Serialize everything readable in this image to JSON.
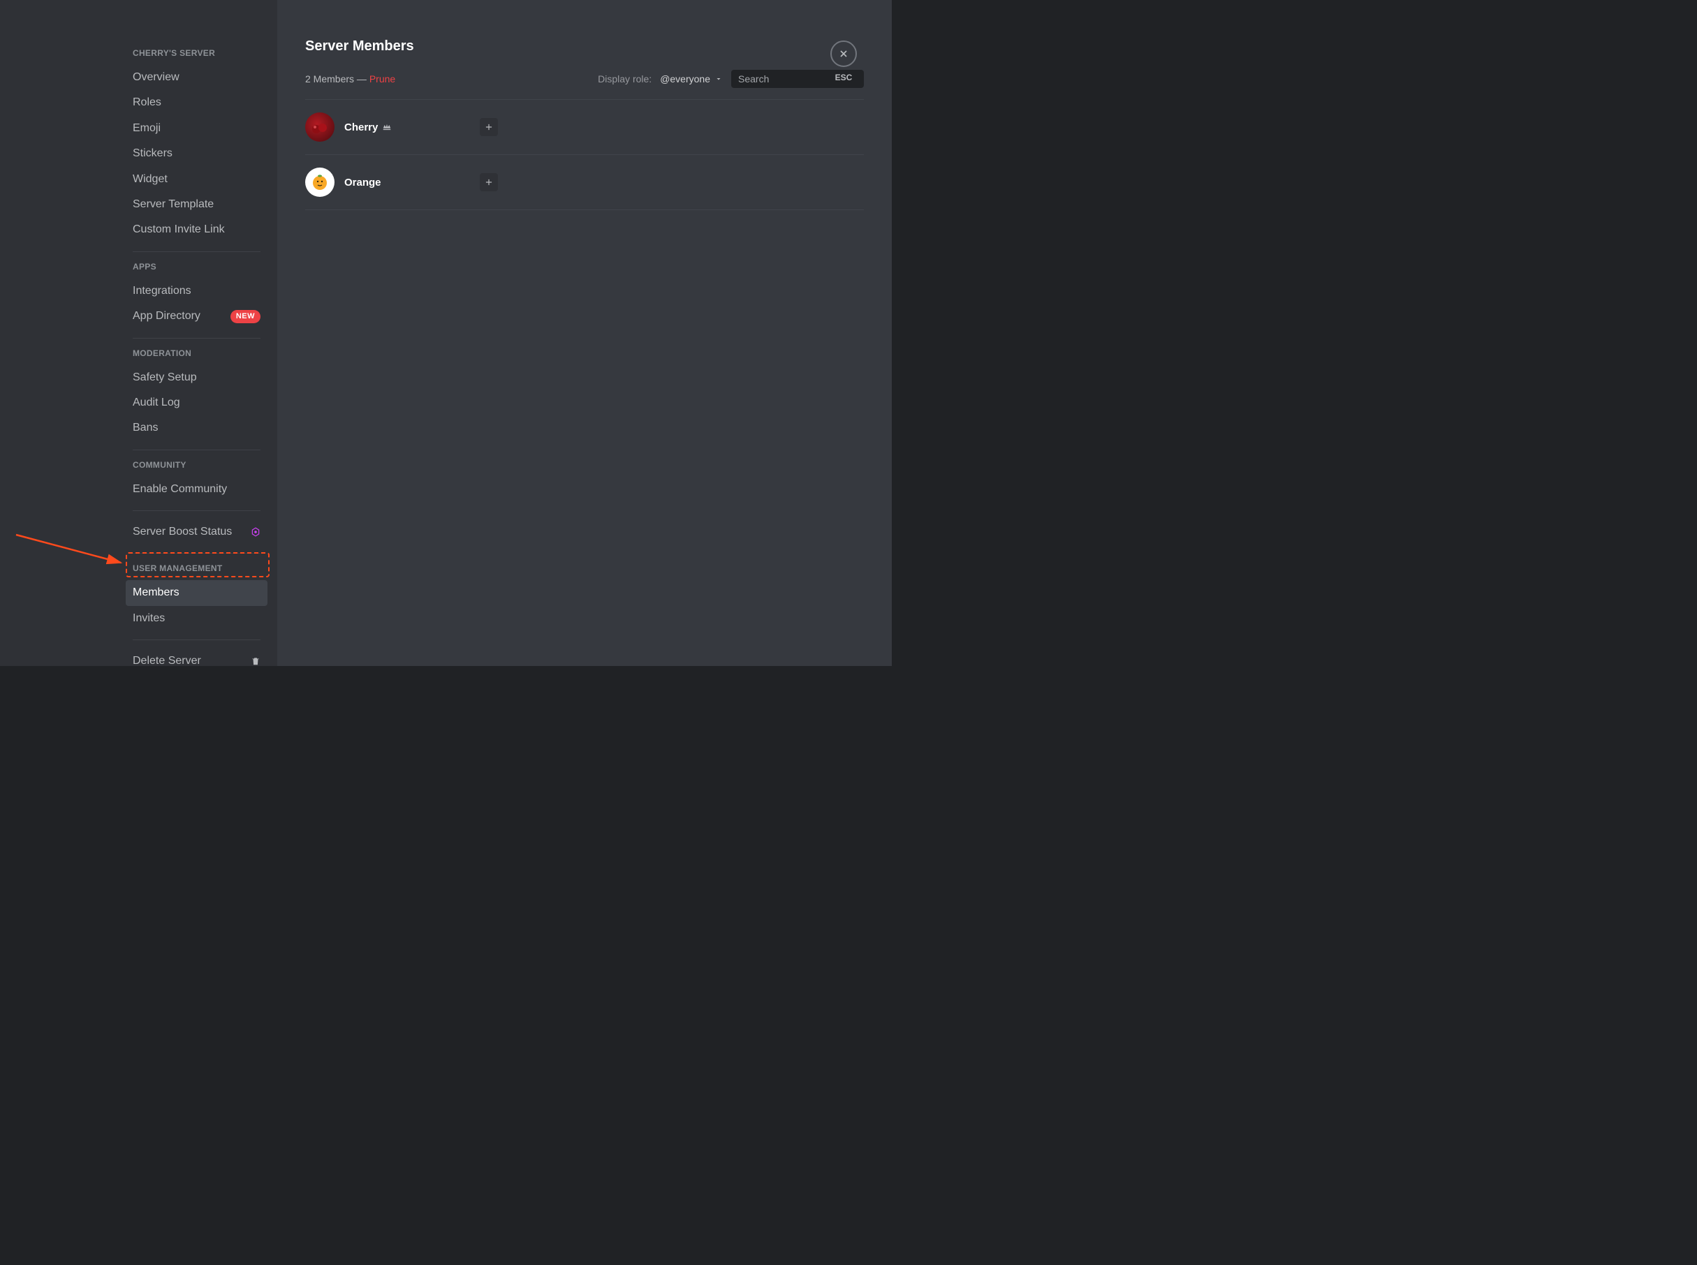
{
  "sidebar": {
    "sections": [
      {
        "header": "CHERRY'S SERVER",
        "items": [
          {
            "label": "Overview"
          },
          {
            "label": "Roles"
          },
          {
            "label": "Emoji"
          },
          {
            "label": "Stickers"
          },
          {
            "label": "Widget"
          },
          {
            "label": "Server Template"
          },
          {
            "label": "Custom Invite Link"
          }
        ]
      },
      {
        "header": "APPS",
        "items": [
          {
            "label": "Integrations"
          },
          {
            "label": "App Directory",
            "badge": "NEW"
          }
        ]
      },
      {
        "header": "MODERATION",
        "items": [
          {
            "label": "Safety Setup"
          },
          {
            "label": "Audit Log"
          },
          {
            "label": "Bans"
          }
        ]
      },
      {
        "header": "COMMUNITY",
        "items": [
          {
            "label": "Enable Community"
          }
        ]
      },
      {
        "header": "",
        "items": [
          {
            "label": "Server Boost Status",
            "icon": "boost"
          }
        ]
      },
      {
        "header": "USER MANAGEMENT",
        "items": [
          {
            "label": "Members",
            "active": true
          },
          {
            "label": "Invites"
          }
        ]
      },
      {
        "header": "",
        "items": [
          {
            "label": "Delete Server",
            "icon": "trash"
          }
        ]
      }
    ]
  },
  "main": {
    "title": "Server Members",
    "member_count_text": "2 Members —",
    "prune_label": "Prune",
    "display_role_label": "Display role:",
    "role_selected": "@everyone",
    "search_placeholder": "Search",
    "members": [
      {
        "name": "Cherry",
        "owner": true,
        "avatar_bg": "radial-gradient(circle at 40% 40%, #7a0f14, #3a0608)"
      },
      {
        "name": "Orange",
        "owner": false,
        "avatar_bg": "#ffffff",
        "avatar_emoji": "🍊"
      }
    ]
  },
  "close": {
    "esc_label": "ESC"
  },
  "colors": {
    "accent_red": "#ed4245",
    "annotation": "#ff4a1c",
    "boost_purple": "#d042f8"
  }
}
